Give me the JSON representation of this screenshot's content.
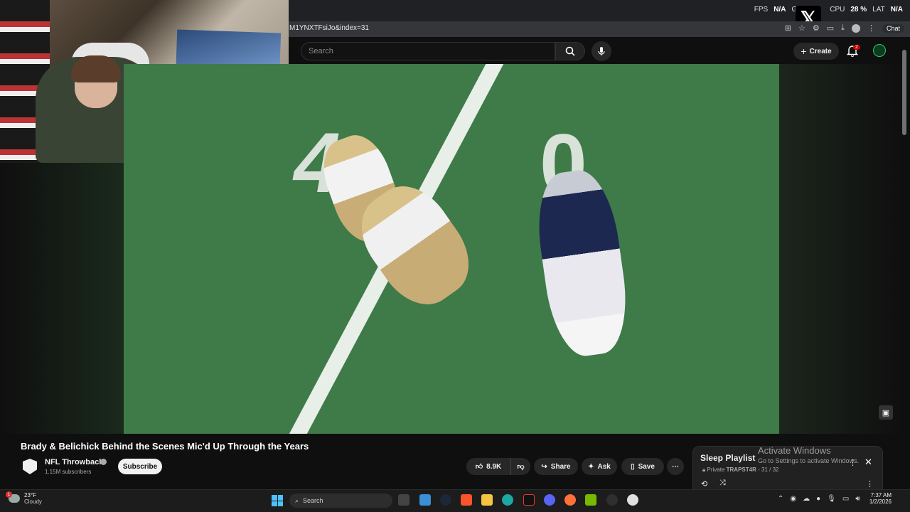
{
  "overlay_stats": {
    "fps_label": "FPS",
    "fps_value": "N/A",
    "gpu_label": "G",
    "cpu_label": "CPU",
    "cpu_value": "28 %",
    "lat_label": "LAT",
    "lat_value": "N/A"
  },
  "browser": {
    "url": "M1YNXTFsiJo&index=31",
    "chat_label": "Chat"
  },
  "youtube_header": {
    "search_placeholder": "Search",
    "create_label": "Create",
    "notification_count": "2"
  },
  "video": {
    "title": "Brady & Belichick Behind the Scenes Mic'd Up Through the Years",
    "channel_name": "NFL Throwback",
    "subscribers": "1.15M subscribers",
    "subscribe_label": "Subscribe",
    "like_count": "8.9K",
    "share_label": "Share",
    "ask_label": "Ask",
    "save_label": "Save",
    "field_number_left": "4",
    "field_number_right": "0"
  },
  "playlist": {
    "title": "Sleep Playlist",
    "privacy": "Private",
    "owner": "TRAPST4R",
    "position": "- 31 / 32"
  },
  "windows_watermark": {
    "line1": "Activate Windows",
    "line2": "Go to Settings to activate Windows."
  },
  "taskbar": {
    "temperature": "23°F",
    "condition": "Cloudy",
    "weather_badge": "1",
    "search_label": "Search",
    "time": "7:37 AM",
    "date": "1/2/2026"
  },
  "colors": {
    "accent_blue": "#4cc2ff",
    "notification_red": "#cc0000",
    "field_green": "#3f7a49"
  }
}
